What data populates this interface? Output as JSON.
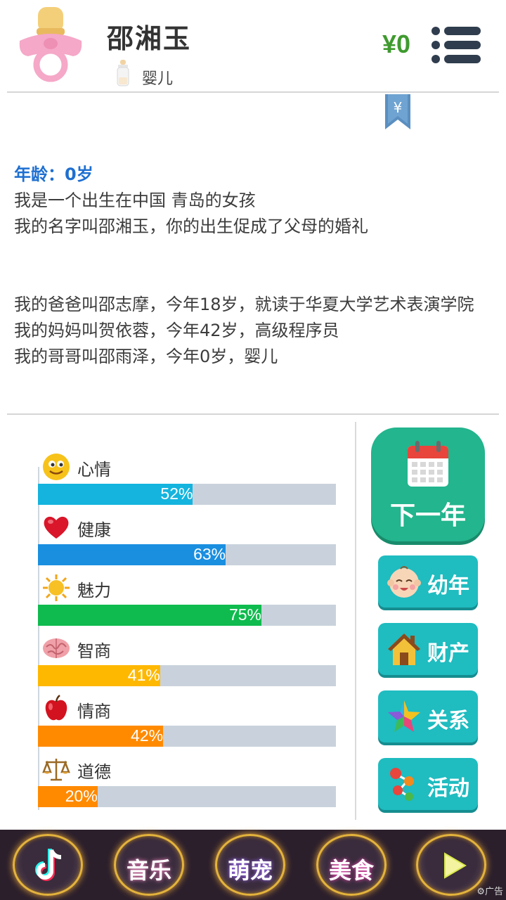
{
  "header": {
    "name": "邵湘玉",
    "stage": "婴儿",
    "money": "¥0",
    "bookmark_symbol": "¥",
    "menu_icon": "menu-icon"
  },
  "story": {
    "age_line": "年龄：0岁",
    "lines": [
      "我是一个出生在中国 青岛的女孩",
      "我的名字叫邵湘玉，你的出生促成了父母的婚礼",
      "",
      "",
      "我的爸爸叫邵志摩，今年18岁，就读于华夏大学艺术表演学院",
      "我的妈妈叫贺依蓉，今年42岁，高级程序员",
      "我的哥哥叫邵雨泽，今年0岁，婴儿"
    ]
  },
  "stats": [
    {
      "label": "心情",
      "value": 52,
      "text": "52%",
      "color": "#14b4de",
      "icon": "smiley-icon"
    },
    {
      "label": "健康",
      "value": 63,
      "text": "63%",
      "color": "#1a8fe0",
      "icon": "heart-icon"
    },
    {
      "label": "魅力",
      "value": 75,
      "text": "75%",
      "color": "#0fbb4e",
      "icon": "sun-icon"
    },
    {
      "label": "智商",
      "value": 41,
      "text": "41%",
      "color": "#ffb800",
      "icon": "brain-icon"
    },
    {
      "label": "情商",
      "value": 42,
      "text": "42%",
      "color": "#ff8a00",
      "icon": "apple-icon"
    },
    {
      "label": "道德",
      "value": 20,
      "text": "20%",
      "color": "#ff8a00",
      "icon": "scales-icon"
    }
  ],
  "actions": {
    "next_year": "下一年",
    "childhood": "幼年",
    "property": "财产",
    "relations": "关系",
    "activities": "活动"
  },
  "bottom_bar": {
    "items": [
      "音乐",
      "萌宠",
      "美食"
    ],
    "ad_label": "广告"
  },
  "colors": {
    "money": "#3f9a2f",
    "age": "#1e6fd0",
    "next_year_bg": "#23b58d",
    "side_btn_bg": "#1fbcc0",
    "bottom_bg": "#2b1f2c"
  }
}
